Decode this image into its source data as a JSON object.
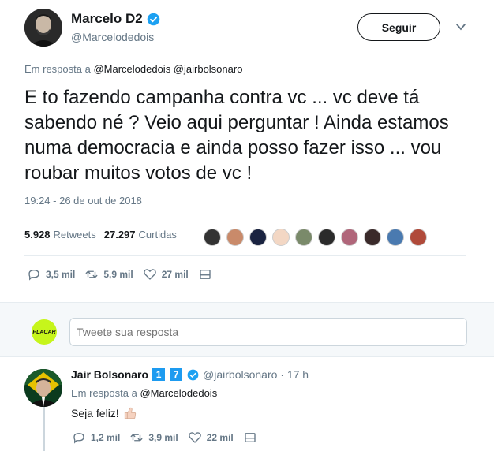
{
  "tweet": {
    "author_name": "Marcelo D2",
    "author_handle": "@Marcelodedois",
    "follow_label": "Seguir",
    "reply_to_prefix": "Em resposta a",
    "reply_to_mentions": "@Marcelodedois @jairbolsonaro",
    "text": "E to fazendo campanha contra vc ... vc deve tá sabendo né ? Veio aqui perguntar ! Ainda estamos numa democracia e ainda posso fazer isso ... vou roubar muitos votos de vc !",
    "timestamp": "19:24 - 26 de out de 2018",
    "retweets_count": "5.928",
    "retweets_label": "Retweets",
    "likes_count": "27.297",
    "likes_label": "Curtidas",
    "liker_colors": [
      "#333333",
      "#c98a6a",
      "#1a2340",
      "#f3d7c4",
      "#7a8a6a",
      "#2b2b2b",
      "#b0667a",
      "#3a2a2a",
      "#4a7ab0",
      "#b04a3a"
    ],
    "actions": {
      "replies": "3,5 mil",
      "retweets": "5,9 mil",
      "likes": "27 mil"
    }
  },
  "reply_box": {
    "avatar_label": "PLACAR",
    "placeholder": "Tweete sua resposta"
  },
  "reply": {
    "author_name": "Jair Bolsonaro",
    "badge_1": "1",
    "badge_2": "7",
    "handle_time": "@jairbolsonaro · 17 h",
    "reply_to_prefix": "Em resposta a",
    "reply_to_mention": "@Marcelodedois",
    "text": "Seja feliz!",
    "actions": {
      "replies": "1,2 mil",
      "retweets": "3,9 mil",
      "likes": "22 mil"
    }
  },
  "colors": {
    "verified": "#1da1f2",
    "muted": "#657786",
    "placar": "#c6f51b"
  }
}
